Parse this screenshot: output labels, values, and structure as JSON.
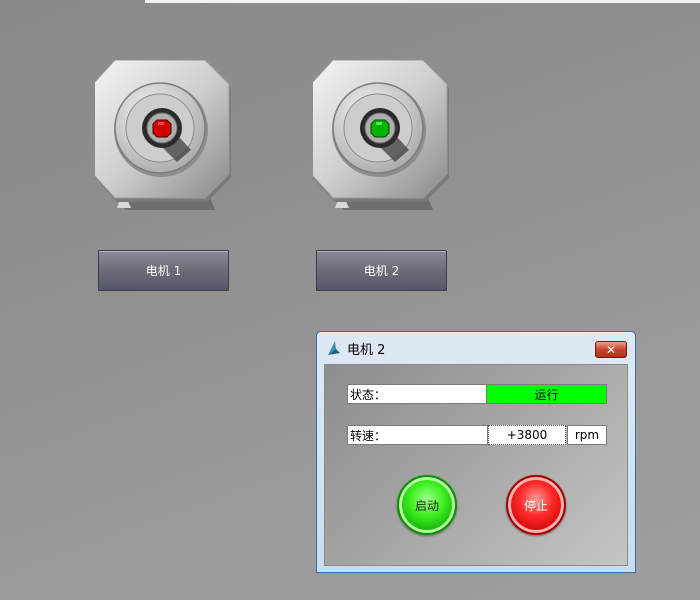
{
  "motors": [
    {
      "button_label": "电机 1",
      "indicator_color": "#d40000",
      "indicator_state": "stopped"
    },
    {
      "button_label": "电机 2",
      "indicator_color": "#00b400",
      "indicator_state": "running"
    }
  ],
  "dialog": {
    "title": "电机 2",
    "close_symbol": "✕",
    "status_label": "状态：",
    "status_value": "运行",
    "status_color": "#00ff00",
    "speed_label": "转速：",
    "speed_value": "+3800",
    "speed_unit": "rpm",
    "start_label": "启动",
    "stop_label": "停止"
  },
  "icons": {
    "title": "sail-app-icon",
    "close": "close-icon"
  }
}
